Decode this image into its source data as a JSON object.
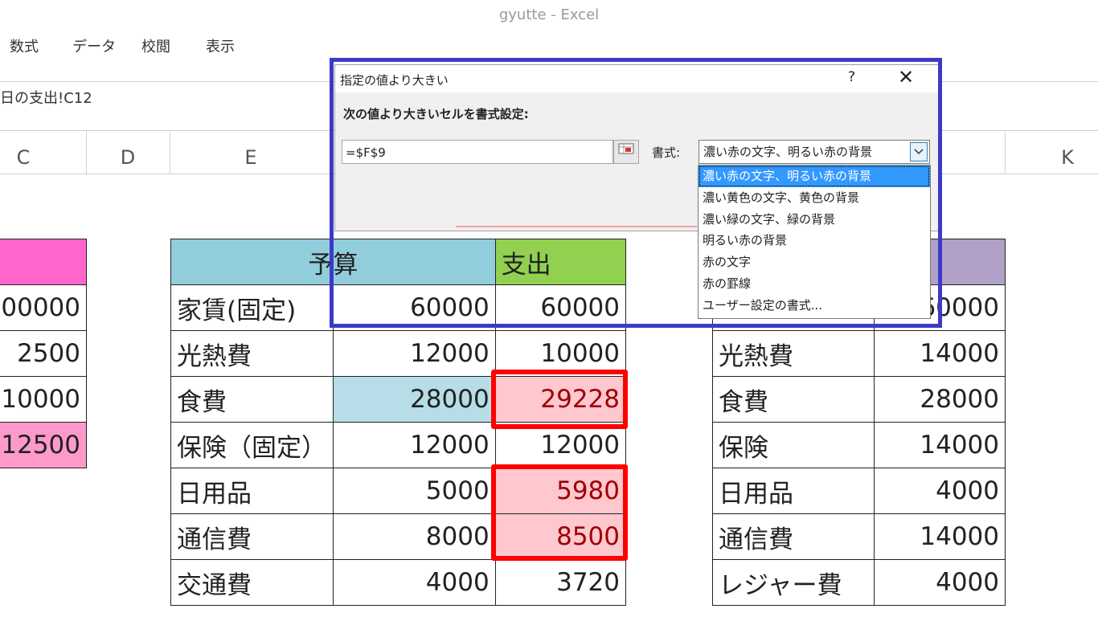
{
  "window": {
    "title": "gyutte - Excel"
  },
  "ribbon": {
    "tabs": [
      "数式",
      "データ",
      "校閲",
      "表示"
    ]
  },
  "formula_bar": {
    "text": "日の支出!C12"
  },
  "columns": [
    "C",
    "D",
    "E",
    "K"
  ],
  "left_table": {
    "values": [
      "00000",
      "2500",
      "10000",
      "12500"
    ]
  },
  "budget_table": {
    "header_budget": "予算",
    "header_expense": "支出",
    "rows": [
      {
        "item": "家賃(固定)",
        "budget": "60000",
        "expense": "60000"
      },
      {
        "item": "光熱費",
        "budget": "12000",
        "expense": "10000"
      },
      {
        "item": "食費",
        "budget": "28000",
        "expense": "29228"
      },
      {
        "item": "保険（固定）",
        "budget": "12000",
        "expense": "12000"
      },
      {
        "item": "日用品",
        "budget": "5000",
        "expense": "5980"
      },
      {
        "item": "通信費",
        "budget": "8000",
        "expense": "8500"
      },
      {
        "item": "交通費",
        "budget": "4000",
        "expense": "3720"
      }
    ]
  },
  "right_table": {
    "rows": [
      {
        "item": "",
        "value": "60000"
      },
      {
        "item": "光熱費",
        "value": "14000"
      },
      {
        "item": "食費",
        "value": "28000"
      },
      {
        "item": "保険",
        "value": "14000"
      },
      {
        "item": "日用品",
        "value": "4000"
      },
      {
        "item": "通信費",
        "value": "14000"
      },
      {
        "item": "レジャー費",
        "value": "4000"
      }
    ]
  },
  "dialog": {
    "title": "指定の値より大きい",
    "help": "?",
    "close": "✕",
    "label": "次の値より大きいセルを書式設定:",
    "value": "=$F$9",
    "format_label": "書式:",
    "format_selected": "濃い赤の文字、明るい赤の背景",
    "format_options": [
      "濃い赤の文字、明るい赤の背景",
      "濃い黄色の文字、黄色の背景",
      "濃い緑の文字、緑の背景",
      "明るい赤の背景",
      "赤の文字",
      "赤の罫線",
      "ユーザー設定の書式..."
    ]
  },
  "colors": {
    "budget_header": "#92cddc",
    "expense_header": "#92d050",
    "left_header": "#ff66cc",
    "right_header": "#b1a0c7",
    "highlight_bg": "#ffc7ce",
    "highlight_text": "#9c0006",
    "annotation_red": "#ff0000",
    "annotation_blue": "#3b3bc8"
  }
}
